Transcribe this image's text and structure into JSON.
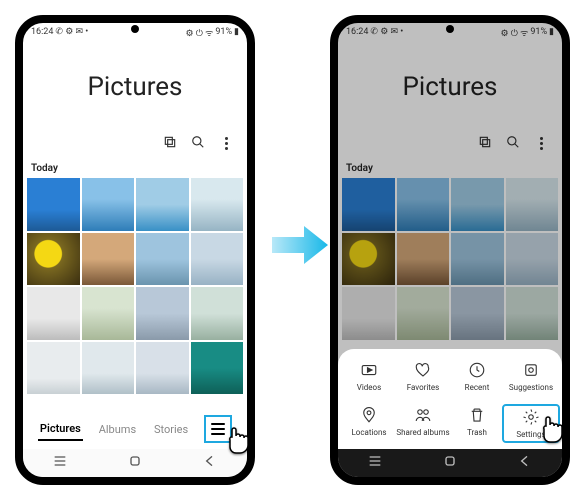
{
  "status": {
    "time": "16:24",
    "battery": "91%"
  },
  "header": {
    "title": "Pictures"
  },
  "section": {
    "label": "Today"
  },
  "tabs": {
    "pictures": "Pictures",
    "albums": "Albums",
    "stories": "Stories"
  },
  "sheet": {
    "videos": "Videos",
    "favorites": "Favorites",
    "recent": "Recent",
    "suggestions": "Suggestions",
    "locations": "Locations",
    "shared": "Shared albums",
    "trash": "Trash",
    "settings": "Settings"
  }
}
